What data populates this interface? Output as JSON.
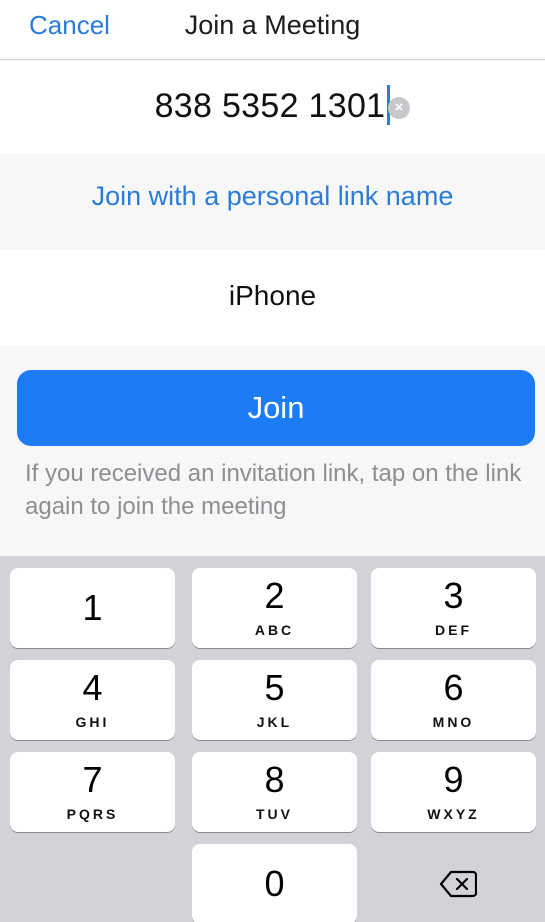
{
  "nav": {
    "cancel_label": "Cancel",
    "title": "Join a Meeting"
  },
  "meeting_id": {
    "value": "838 5352 1301",
    "clear_icon": "clear-circle-x-icon"
  },
  "personal_link": {
    "label": "Join with a personal link name"
  },
  "display_name": {
    "value": "iPhone"
  },
  "join": {
    "button_label": "Join",
    "hint": "If you received an invitation link, tap on the link again to join the meeting"
  },
  "keypad": {
    "keys": [
      {
        "num": "1",
        "letters": ""
      },
      {
        "num": "2",
        "letters": "ABC"
      },
      {
        "num": "3",
        "letters": "DEF"
      },
      {
        "num": "4",
        "letters": "GHI"
      },
      {
        "num": "5",
        "letters": "JKL"
      },
      {
        "num": "6",
        "letters": "MNO"
      },
      {
        "num": "7",
        "letters": "PQRS"
      },
      {
        "num": "8",
        "letters": "TUV"
      },
      {
        "num": "9",
        "letters": "WXYZ"
      },
      {
        "num": "0",
        "letters": ""
      }
    ],
    "backspace_icon": "backspace-icon"
  },
  "colors": {
    "accent": "#2b7cd8",
    "join_button": "#1c7cf6",
    "keypad_bg": "#d1d3d9"
  }
}
